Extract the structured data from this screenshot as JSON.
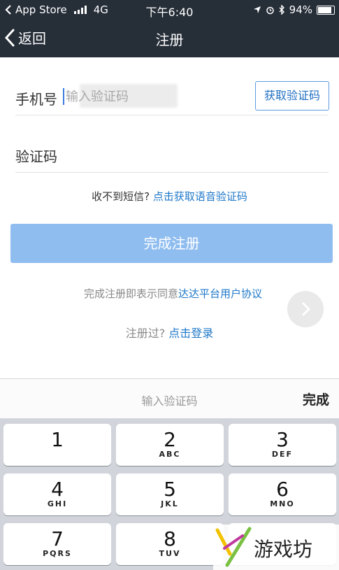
{
  "status_bar": {
    "carrier": "App Store",
    "network": "4G",
    "time": "下午6:40",
    "battery": "94%"
  },
  "nav": {
    "back_label": "返回",
    "title": "注册"
  },
  "form": {
    "phone_label": "手机号",
    "code_label": "验证码",
    "code_placeholder": "输入验证码",
    "get_code_button": "获取验证码"
  },
  "voice": {
    "prefix": "收不到短信?",
    "link": "点击获取语音验证码"
  },
  "submit_button": "完成注册",
  "agreement": {
    "prefix": "完成注册即表示同意",
    "link": "达达平台用户协议"
  },
  "login": {
    "prefix": "注册过?",
    "link": "点击登录"
  },
  "keyboard_bar": {
    "hint": "输入验证码",
    "done": "完成"
  },
  "keypad": [
    {
      "num": "1",
      "letters": ""
    },
    {
      "num": "2",
      "letters": "ABC"
    },
    {
      "num": "3",
      "letters": "DEF"
    },
    {
      "num": "4",
      "letters": "GHI"
    },
    {
      "num": "5",
      "letters": "JKL"
    },
    {
      "num": "6",
      "letters": "MNO"
    },
    {
      "num": "7",
      "letters": "PQRS"
    },
    {
      "num": "8",
      "letters": "TUV"
    }
  ],
  "watermark": {
    "text": "游戏坊"
  },
  "colors": {
    "nav_bg": "#262e38",
    "accent": "#1f78c9",
    "submit_bg": "#8fbdf0"
  }
}
